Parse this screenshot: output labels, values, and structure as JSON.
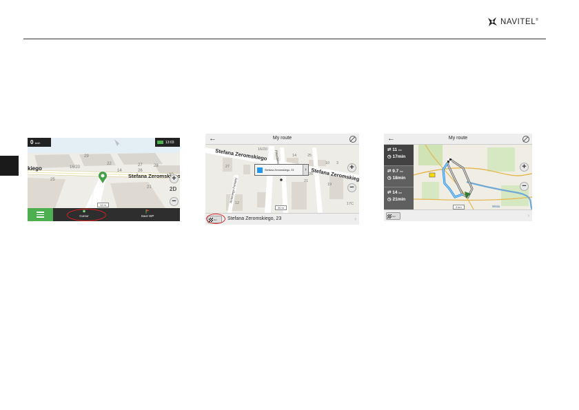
{
  "brand": {
    "name": "NAVITEL",
    "reg": "®"
  },
  "screen1": {
    "speed": "0",
    "speed_unit": "km/h",
    "clock": "13:03",
    "streets": [
      "Stefana Zeromskiego",
      "kiego"
    ],
    "house_numbers": [
      "29",
      "22",
      "16/20",
      "14",
      "27",
      "28",
      "25",
      "26",
      "21",
      "10",
      "25"
    ],
    "scale": "12 m",
    "two_d": "2D",
    "cursor_label": "Cursor",
    "save_wp_label": "Save WP"
  },
  "screen2": {
    "title": "My route",
    "streets": [
      "Stefana Zeromskiego",
      "Stefana Zeromskiego",
      "Pilsudskiego",
      "Antoniego Fontany"
    ],
    "house_numbers": [
      "16/20",
      "27",
      "14",
      "25",
      "10",
      "3",
      "25",
      "21",
      "19",
      "12",
      "17C"
    ],
    "popup_address": "Stefana Zeromskiego, 23",
    "scale": "30 m",
    "go_label": "Go!",
    "footer_address": "Stefana Zeromskiego, 23"
  },
  "screen3": {
    "title": "My route",
    "routes": [
      {
        "distance": "11",
        "unit": "km",
        "time": "17min"
      },
      {
        "distance": "9.7",
        "unit": "km",
        "time": "18min"
      },
      {
        "distance": "14",
        "unit": "km",
        "time": "21min"
      }
    ],
    "river_label": "Wisla",
    "scale": "3 km",
    "go_label": "Go!"
  }
}
